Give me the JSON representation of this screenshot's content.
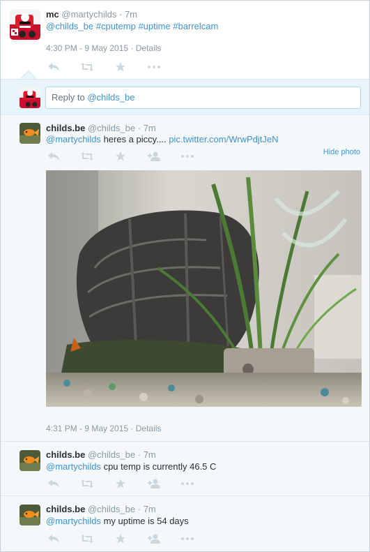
{
  "main_tweet": {
    "name": "mc",
    "handle": "@martychilds",
    "time": "7m",
    "hashtags_line": "@childs_be #cputemp #uptime #barrelcam",
    "timestamp": "4:30 PM - 9 May 2015",
    "details_label": "Details"
  },
  "reply": {
    "prefix": "Reply to",
    "mention": "@childs_be"
  },
  "replies": [
    {
      "name": "childs.be",
      "handle": "@childs_be",
      "time": "7m",
      "mention": "@martychilds",
      "text": "heres a piccy....",
      "link": "pic.twitter.com/WrwPdjtJeN",
      "hide_photo_label": "Hide photo",
      "timestamp": "4:31 PM - 9 May 2015",
      "details_label": "Details"
    },
    {
      "name": "childs.be",
      "handle": "@childs_be",
      "time": "7m",
      "mention": "@martychilds",
      "text": "cpu temp is currently 46.5 C"
    },
    {
      "name": "childs.be",
      "handle": "@childs_be",
      "time": "7m",
      "mention": "@martychilds",
      "text": "my uptime is 54 days"
    }
  ],
  "separator": "·",
  "icons": [
    "reply-icon",
    "retweet-icon",
    "favorite-icon",
    "follow-icon",
    "more-icon",
    "avatar-car",
    "avatar-goldfish"
  ],
  "colors": {
    "link": "#3b94d9",
    "muted": "#8899a6",
    "reply_panel": "#e8f4fb",
    "thread_bg": "#f5f8fa",
    "action_icon": "#ccd6dd"
  }
}
